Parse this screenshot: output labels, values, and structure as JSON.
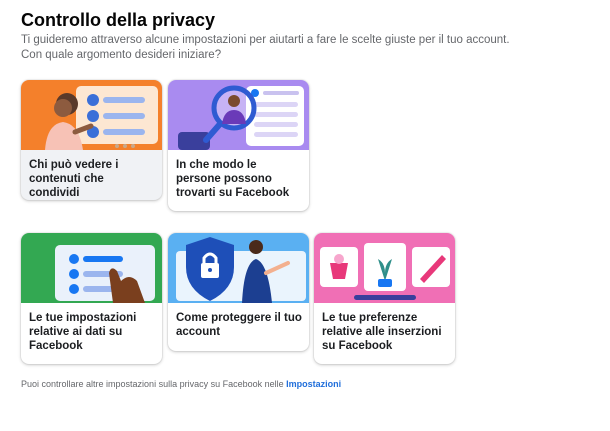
{
  "header": {
    "title": "Controllo della privacy",
    "subtitle_line1": "Ti guideremo attraverso alcune impostazioni per aiutarti a fare le scelte giuste per il tuo account.",
    "subtitle_line2": "Con quale argomento desideri iniziare?"
  },
  "cards": [
    {
      "label": "Chi può vedere i contenuti che condividi",
      "color": "#f4802b"
    },
    {
      "label": "In che modo le persone possono trovarti su Facebook",
      "color": "#a98bf0"
    },
    {
      "label": "Le tue impostazioni relative ai dati su Facebook",
      "color": "#33a852"
    },
    {
      "label": "Come proteggere il tuo account",
      "color": "#5ab0f2"
    },
    {
      "label": "Le tue preferenze relative alle inserzioni su Facebook",
      "color": "#f06fb5"
    }
  ],
  "footer": {
    "text": "Puoi controllare altre impostazioni sulla privacy su Facebook nelle ",
    "link": "Impostazioni"
  },
  "icons": [
    "padlock-icon",
    "shield-icon",
    "magnifier-icon",
    "facebook-icon",
    "plant-icon",
    "pencil-icon"
  ]
}
